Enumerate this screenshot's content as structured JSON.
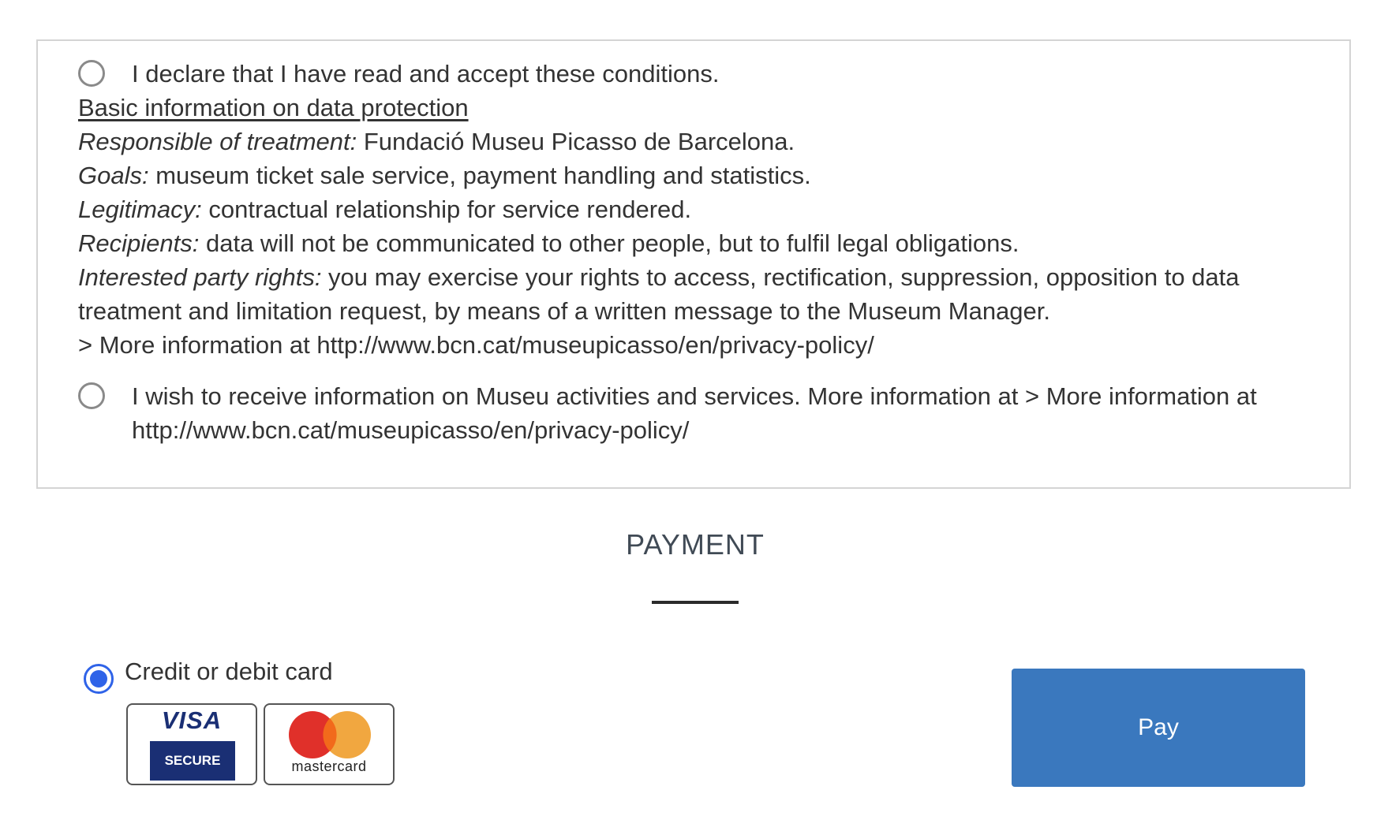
{
  "conditions": {
    "accept_text": "I declare that I have read and accept these conditions.",
    "data_protection_link": "Basic information on data protection",
    "items": [
      {
        "label": "Responsible of treatment:",
        "text": " Fundació Museu Picasso de Barcelona."
      },
      {
        "label": "Goals:",
        "text": " museum ticket sale service, payment handling and statistics."
      },
      {
        "label": "Legitimacy:",
        "text": " contractual relationship for service rendered."
      },
      {
        "label": "Recipients:",
        "text": " data will not be communicated to other people, but to fulfil legal obligations."
      },
      {
        "label": "Interested party rights:",
        "text": " you may exercise your rights to access, rectification, suppression, opposition to data treatment and limitation request, by means of a written message to the Museum Manager."
      }
    ],
    "more_info": "> More information at http://www.bcn.cat/museupicasso/en/privacy-policy/",
    "newsletter_text": "I wish to receive information on Museu activities and services. More information at > More information at http://www.bcn.cat/museupicasso/en/privacy-policy/"
  },
  "payment": {
    "title": "PAYMENT",
    "method_label": "Credit or debit card",
    "visa_word": "VISA",
    "visa_secure": "SECURE",
    "mastercard_word": "mastercard",
    "pay_button": "Pay"
  },
  "colors": {
    "accent_blue": "#2f63e8",
    "pay_button": "#3a78be",
    "visa_navy": "#1a2f74",
    "mc_red": "#e0302a",
    "mc_orange": "#f0a030"
  }
}
